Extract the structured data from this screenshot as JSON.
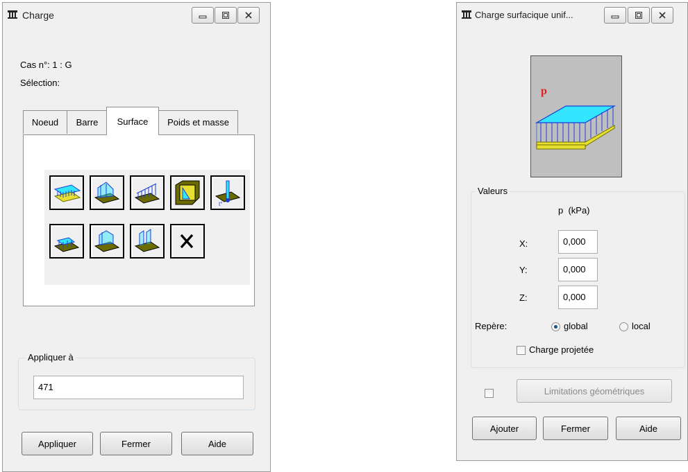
{
  "left_dialog": {
    "title": "Charge",
    "case_label": "Cas n°: 1 : G",
    "selection_label": "Sélection:",
    "tabs": [
      "Noeud",
      "Barre",
      "Surface",
      "Poids et masse"
    ],
    "active_tab": "Surface",
    "load_icons": [
      "uniform-surface-load-icon",
      "linear-surface-load-icon",
      "linear-edge-load-icon",
      "hydrostatic-pressure-icon",
      "thermal-load-icon",
      "surface-load-contour-icon",
      "linear-3p-load-icon",
      "planar-load-icon",
      "delete-load-icon"
    ],
    "apply_group_label": "Appliquer à",
    "apply_value": "471",
    "buttons": {
      "apply": "Appliquer",
      "close": "Fermer",
      "help": "Aide"
    }
  },
  "right_dialog": {
    "title": "Charge surfacique unif...",
    "preview_label": "p",
    "values_group_label": "Valeurs",
    "column_header": "p  (kPa)",
    "fields": [
      {
        "label": "X:",
        "value": "0,000"
      },
      {
        "label": "Y:",
        "value": "0,000"
      },
      {
        "label": "Z:",
        "value": "0,000"
      }
    ],
    "frame_label": "Repère:",
    "frame_options": [
      "global",
      "local"
    ],
    "frame_selected": "global",
    "projected_label": "Charge projetée",
    "projected_checked": false,
    "geo_limits_checked": false,
    "geo_limits_button": "Limitations géométriques",
    "buttons": {
      "add": "Ajouter",
      "close": "Fermer",
      "help": "Aide"
    }
  },
  "colors": {
    "accent_cyan": "#33e5ff",
    "plate_yellow": "#e8e030",
    "plate_olive": "#6b6b00",
    "load_blue": "#1a3fd6",
    "label_red": "#e02020"
  }
}
